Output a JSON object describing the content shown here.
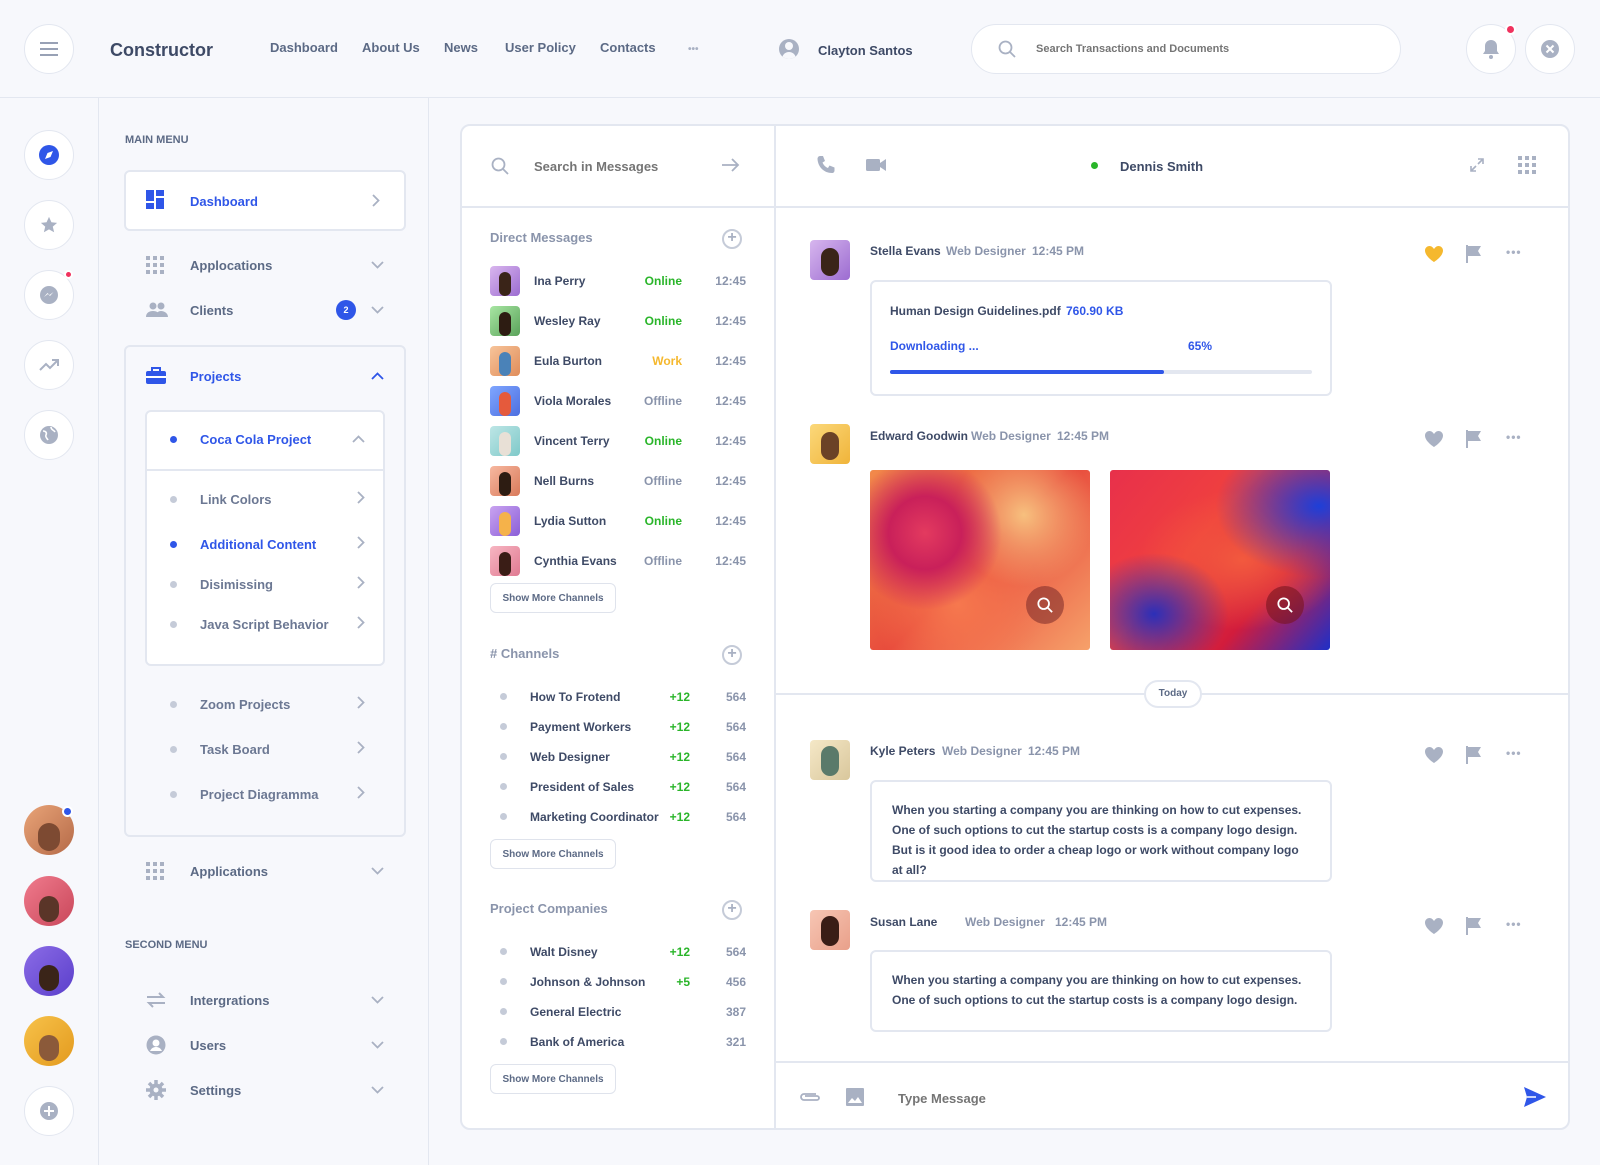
{
  "header": {
    "app_title": "Constructor",
    "nav": [
      "Dashboard",
      "About Us",
      "News",
      "User Policy",
      "Contacts"
    ],
    "more": "•••",
    "user_name": "Clayton Santos",
    "search_placeholder": "Search Transactions and Documents"
  },
  "sidebar": {
    "main_menu_title": "MAIN MENU",
    "dashboard": "Dashboard",
    "applications_top": "Applocations",
    "clients": "Clients",
    "clients_badge": "2",
    "projects": "Projects",
    "coca_cola": "Coca Cola Project",
    "sub_items": [
      "Link Colors",
      "Additional Content",
      "Disimissing",
      "Java Script Behavior"
    ],
    "more_items": [
      "Zoom Projects",
      "Task Board",
      "Project Diagramma"
    ],
    "applications_bottom": "Applications",
    "second_menu_title": "SECOND MENU",
    "second_items": [
      "Intergrations",
      "Users",
      "Settings"
    ]
  },
  "messages_panel": {
    "search_placeholder": "Search in Messages",
    "direct_title": "Direct Messages",
    "direct": [
      {
        "name": "Ina Perry",
        "status": "Online",
        "time": "12:45",
        "color": "#2ab52a"
      },
      {
        "name": "Wesley Ray",
        "status": "Online",
        "time": "12:45",
        "color": "#2ab52a"
      },
      {
        "name": "Eula Burton",
        "status": "Work",
        "time": "12:45",
        "color": "#f5b82e"
      },
      {
        "name": "Viola Morales",
        "status": "Offline",
        "time": "12:45",
        "color": "#8a94ab"
      },
      {
        "name": "Vincent Terry",
        "status": "Online",
        "time": "12:45",
        "color": "#2ab52a"
      },
      {
        "name": "Nell Burns",
        "status": "Offline",
        "time": "12:45",
        "color": "#8a94ab"
      },
      {
        "name": "Lydia Sutton",
        "status": "Online",
        "time": "12:45",
        "color": "#2ab52a"
      },
      {
        "name": "Cynthia Evans",
        "status": "Offline",
        "time": "12:45",
        "color": "#8a94ab"
      }
    ],
    "show_more": "Show More Channels",
    "channels_title": "# Channels",
    "channels": [
      {
        "name": "How To Frotend",
        "inc": "+12",
        "count": "564"
      },
      {
        "name": "Payment Workers",
        "inc": "+12",
        "count": "564"
      },
      {
        "name": "Web Designer",
        "inc": "+12",
        "count": "564"
      },
      {
        "name": "President of Sales",
        "inc": "+12",
        "count": "564"
      },
      {
        "name": "Marketing Coordinator",
        "inc": "+12",
        "count": "564"
      }
    ],
    "companies_title": "Project Companies",
    "companies": [
      {
        "name": "Walt Disney",
        "inc": "+12",
        "count": "564"
      },
      {
        "name": "Johnson & Johnson",
        "inc": "+5",
        "count": "456"
      },
      {
        "name": "General Electric",
        "inc": "",
        "count": "387"
      },
      {
        "name": "Bank of America",
        "inc": "",
        "count": "321"
      }
    ]
  },
  "chat": {
    "contact_name": "Dennis Smith",
    "messages": [
      {
        "name": "Stella Evans",
        "role": "Web Designer",
        "time": "12:45 PM"
      },
      {
        "name": "Edward Goodwin",
        "role": "Web Designer",
        "time": "12:45 PM"
      },
      {
        "name": "Kyle Peters",
        "role": "Web Designer",
        "time": "12:45 PM",
        "text": "When you starting a company you are thinking on how to cut expenses. One of such options to cut the startup costs is a company logo design. But is it good idea to order a cheap logo or work without company logo at all?"
      },
      {
        "name": "Susan Lane",
        "role": "Web Designer",
        "time": "12:45 PM",
        "text": "When you starting a company you are thinking on how to cut expenses. One of such options to cut the startup costs is a company logo design."
      }
    ],
    "file": {
      "name": "Human Design Guidelines.pdf",
      "size": "760.90 KB",
      "status": "Downloading ...",
      "percent_text": "65%",
      "progress": 0.65
    },
    "divider": "Today",
    "input_placeholder": "Type Message"
  },
  "colors": {
    "accent": "#2f56e8",
    "online": "#2ab52a",
    "work": "#f5b82e",
    "badge": "#f0325e"
  }
}
